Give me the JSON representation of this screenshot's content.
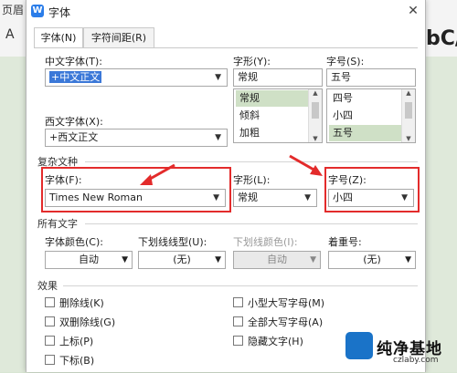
{
  "background": {
    "top_left_text": "页眉",
    "font_icon_text": "A",
    "big_text": "bC/"
  },
  "dialog": {
    "title": "字体",
    "logo_letter": "W",
    "close_glyph": "✕",
    "tabs": [
      {
        "label": "字体(N)"
      },
      {
        "label": "字符间距(R)"
      }
    ],
    "chinese_font": {
      "label": "中文字体(T):",
      "value": "+中文正文"
    },
    "style_top": {
      "label": "字形(Y):",
      "value": "常规",
      "options": [
        "常规",
        "倾斜",
        "加粗"
      ]
    },
    "size_top": {
      "label": "字号(S):",
      "value": "五号",
      "options": [
        "四号",
        "小四",
        "五号"
      ]
    },
    "western_font": {
      "label": "西文字体(X):",
      "value": "+西文正文"
    },
    "complex_section": {
      "title": "复杂文种",
      "font_label": "字体(F):",
      "font_value": "Times New Roman",
      "style_label": "字形(L):",
      "style_value": "常规",
      "size_label": "字号(Z):",
      "size_value": "小四"
    },
    "all_text_section": {
      "title": "所有文字",
      "color_label": "字体颜色(C):",
      "color_value": "自动",
      "underline_type_label": "下划线线型(U):",
      "underline_type_value": "(无)",
      "underline_color_label": "下划线颜色(I):",
      "underline_color_value": "自动",
      "emphasis_label": "着重号:",
      "emphasis_value": "(无)"
    },
    "effects_section": {
      "title": "效果",
      "left": [
        "删除线(K)",
        "双删除线(G)",
        "上标(P)",
        "下标(B)"
      ],
      "right": [
        "小型大写字母(M)",
        "全部大写字母(A)",
        "隐藏文字(H)"
      ]
    }
  },
  "watermark": {
    "text": "纯净基地",
    "url": "czlaby.com"
  },
  "colors": {
    "highlight_red": "#e32b2b",
    "selection_blue": "#3b78d8",
    "list_selection": "#cfe0c6"
  }
}
